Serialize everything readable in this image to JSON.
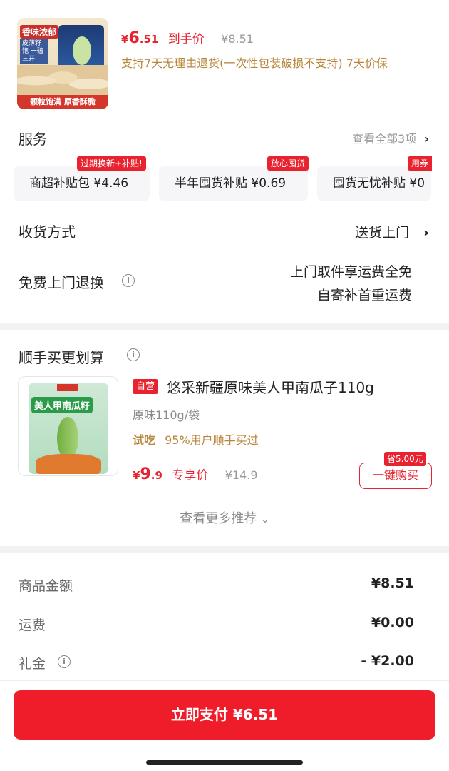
{
  "product": {
    "thumb_tag_top": "香味浓郁",
    "thumb_tag_sub": "皮薄籽饱 一磕三开",
    "thumb_band": "颗粒饱满 原香酥脆",
    "currency": "¥",
    "price_int": "6",
    "price_dec": ".51",
    "price_label": "到手价",
    "orig_price": "¥8.51",
    "policy": "支持7天无理由退货(一次性包装破损不支持) 7天价保"
  },
  "service": {
    "title": "服务",
    "more": "查看全部3项",
    "cards": [
      {
        "name": "商超补贴包",
        "price": "¥4.46",
        "badge": "过期换新+补贴!"
      },
      {
        "name": "半年囤货补贴",
        "price": "¥0.69",
        "badge": "放心囤货"
      },
      {
        "name": "囤货无忧补贴",
        "price": "¥0",
        "badge": "用券"
      }
    ]
  },
  "shipping": {
    "label": "收货方式",
    "value": "送货上门"
  },
  "return": {
    "label": "免费上门退换",
    "line1": "上门取件享运费全免",
    "line2": "自寄补首重运费"
  },
  "recommend": {
    "title": "顺手买更划算",
    "pack_title": "美人甲南瓜籽",
    "tag": "自营",
    "name": "悠采新疆原味美人甲南瓜子110g",
    "spec": "原味110g/袋",
    "try_label": "试吃",
    "try_text": "95%用户顺手买过",
    "currency": "¥",
    "price_int": "9",
    "price_dec": ".9",
    "price_label": "专享价",
    "orig_price": "¥14.9",
    "save_badge": "省5.00元",
    "buy_label": "一键购买",
    "more": "查看更多推荐"
  },
  "summary": {
    "goods_label": "商品金额",
    "goods_value": "¥8.51",
    "freight_label": "运费",
    "freight_value": "¥0.00",
    "gift_label": "礼金",
    "gift_value": "- ¥2.00"
  },
  "pay_button": "立即支付 ¥6.51",
  "colors": {
    "accent": "#e8232f",
    "gold": "#b8863a",
    "pay": "#ef1c2a"
  }
}
